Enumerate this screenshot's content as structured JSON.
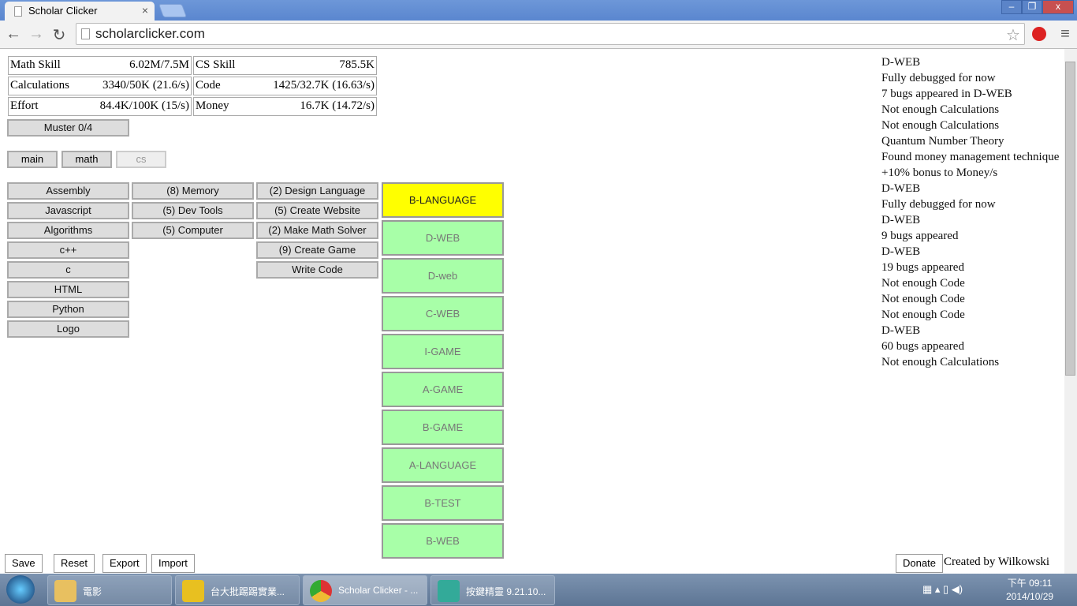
{
  "browser": {
    "tab_title": "Scholar Clicker",
    "url": "scholarclicker.com"
  },
  "stats": [
    {
      "label": "Math Skill",
      "value": "6.02M/7.5M"
    },
    {
      "label": "CS Skill",
      "value": "785.5K"
    },
    {
      "label": "Calculations",
      "value": "3340/50K (21.6/s)"
    },
    {
      "label": "Code",
      "value": "1425/32.7K (16.63/s)"
    },
    {
      "label": "Effort",
      "value": "84.4K/100K (15/s)"
    },
    {
      "label": "Money",
      "value": "16.7K (14.72/s)"
    }
  ],
  "muster": "Muster 0/4",
  "tabs": [
    "main",
    "math",
    "cs"
  ],
  "col1": [
    "Assembly",
    "Javascript",
    "Algorithms",
    "c++",
    "c",
    "HTML",
    "Python",
    "Logo"
  ],
  "col2": [
    "(8) Memory",
    "(5) Dev Tools",
    "(5) Computer"
  ],
  "col3": [
    "(2) Design Language",
    "(5) Create Website",
    "(2) Make Math Solver",
    "(9) Create Game",
    "Write Code"
  ],
  "projects": [
    "B-LANGUAGE",
    "D-WEB",
    "D-web",
    "C-WEB",
    "I-GAME",
    "A-GAME",
    "B-GAME",
    "A-LANGUAGE",
    "B-TEST",
    "B-WEB"
  ],
  "colors": {
    "active_project": "#ffff00",
    "project": "#a8ffa8"
  },
  "log": [
    "D-WEB",
    "Fully debugged for now",
    "7 bugs appeared in D-WEB",
    "Not enough Calculations",
    "Not enough Calculations",
    "Quantum Number Theory",
    "Found money management technique",
    "+10% bonus to Money/s",
    "D-WEB",
    "Fully debugged for now",
    "D-WEB",
    "9 bugs appeared",
    "D-WEB",
    "19 bugs appeared",
    "Not enough Code",
    "Not enough Code",
    "Not enough Code",
    "D-WEB",
    "60 bugs appeared",
    "Not enough Calculations"
  ],
  "footer": {
    "save": "Save",
    "reset": "Reset",
    "export": "Export",
    "import": "Import",
    "donate": "Donate",
    "credit": "Created by Wilkowski"
  },
  "taskbar": {
    "items": [
      "電影",
      "台大批踢踢實業...",
      "Scholar Clicker - ...",
      "按鍵精靈 9.21.10..."
    ],
    "time": "下午 09:11",
    "date": "2014/10/29"
  }
}
